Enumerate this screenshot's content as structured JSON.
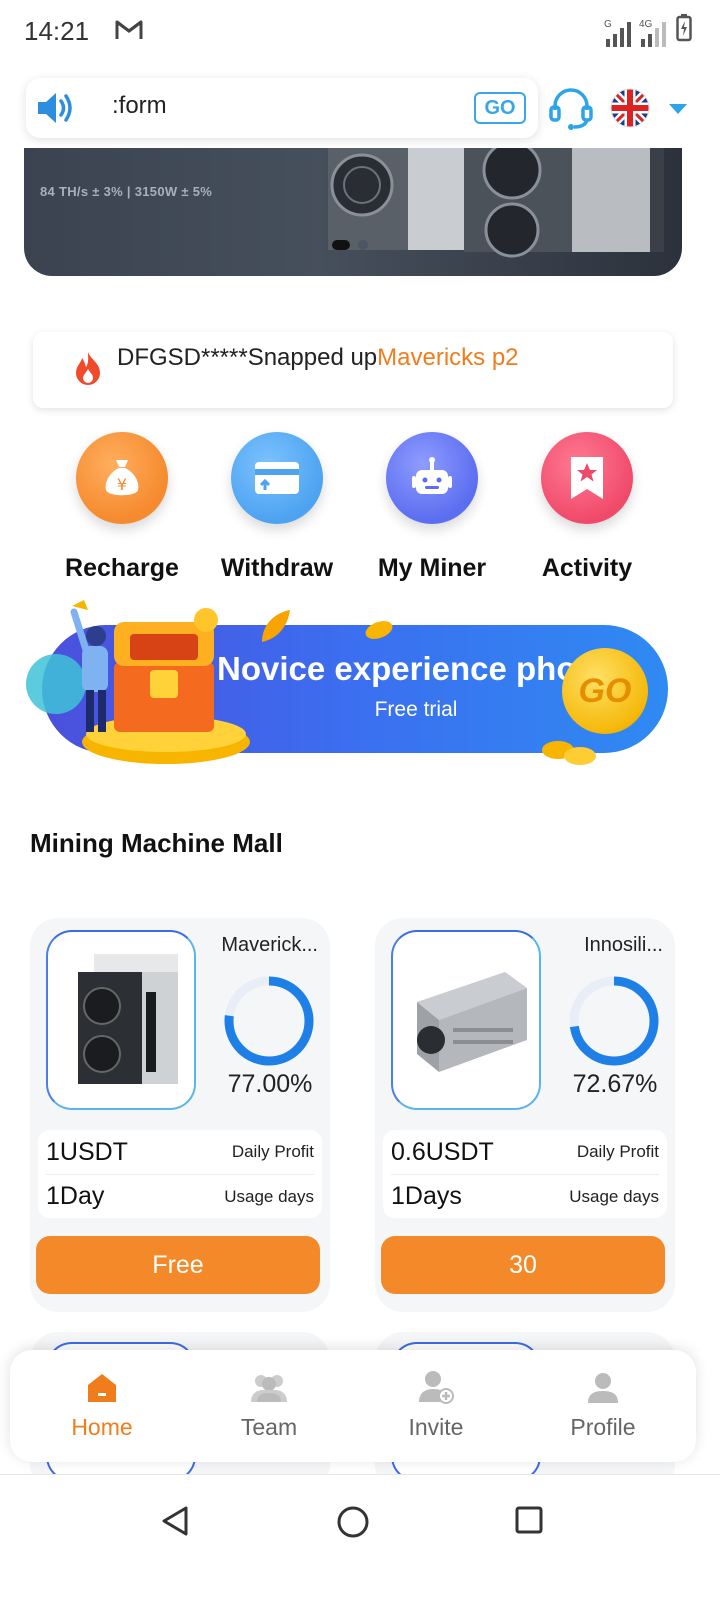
{
  "status_bar": {
    "time": "14:21",
    "mail_icon": "gmail-icon",
    "signal_1_tag": "G",
    "signal_2_tag": "4G"
  },
  "header": {
    "search_text": ":form",
    "go_label": "GO",
    "support_icon": "headset-icon",
    "language_icon": "uk-flag-icon",
    "dropdown_icon": "caret-down-icon"
  },
  "banner": {
    "spec": "84 TH/s ± 3%   |   3150W ± 5%"
  },
  "ticker": {
    "prefix": "DFGSD*****Snapped up",
    "highlight": "Mavericks p2"
  },
  "actions": [
    {
      "label": "Recharge",
      "icon": "money-bag-icon",
      "color": "#f58a2e"
    },
    {
      "label": "Withdraw",
      "icon": "card-icon",
      "color": "#4da3f0"
    },
    {
      "label": "My Miner",
      "icon": "robot-icon",
      "color": "#5b6ef0"
    },
    {
      "label": "Activity",
      "icon": "bookmark-star-icon",
      "color": "#f04a6a"
    }
  ],
  "promo": {
    "title": "Novice experience phone",
    "subtitle": "Free trial",
    "coin_label": "GO"
  },
  "section_title": "Mining Machine Mall",
  "products": [
    {
      "name": "Maverick...",
      "progress": "77.00%",
      "progress_value": 0.77,
      "profit_value": "1USDT",
      "profit_label": "Daily Profit",
      "days_value": "1Day",
      "days_label": "Usage days",
      "button": "Free"
    },
    {
      "name": "Innosili...",
      "progress": "72.67%",
      "progress_value": 0.7267,
      "profit_value": "0.6USDT",
      "profit_label": "Daily Profit",
      "days_value": "1Days",
      "days_label": "Usage days",
      "button": "30"
    }
  ],
  "tabs": [
    {
      "label": "Home",
      "icon": "home-icon",
      "active": true
    },
    {
      "label": "Team",
      "icon": "team-icon",
      "active": false
    },
    {
      "label": "Invite",
      "icon": "invite-user-icon",
      "active": false
    },
    {
      "label": "Profile",
      "icon": "profile-icon",
      "active": false
    }
  ],
  "colors": {
    "accent": "#f4892a",
    "highlight": "#f07d1c",
    "ring": "#1e7fe6",
    "go": "#3aa6e8"
  }
}
